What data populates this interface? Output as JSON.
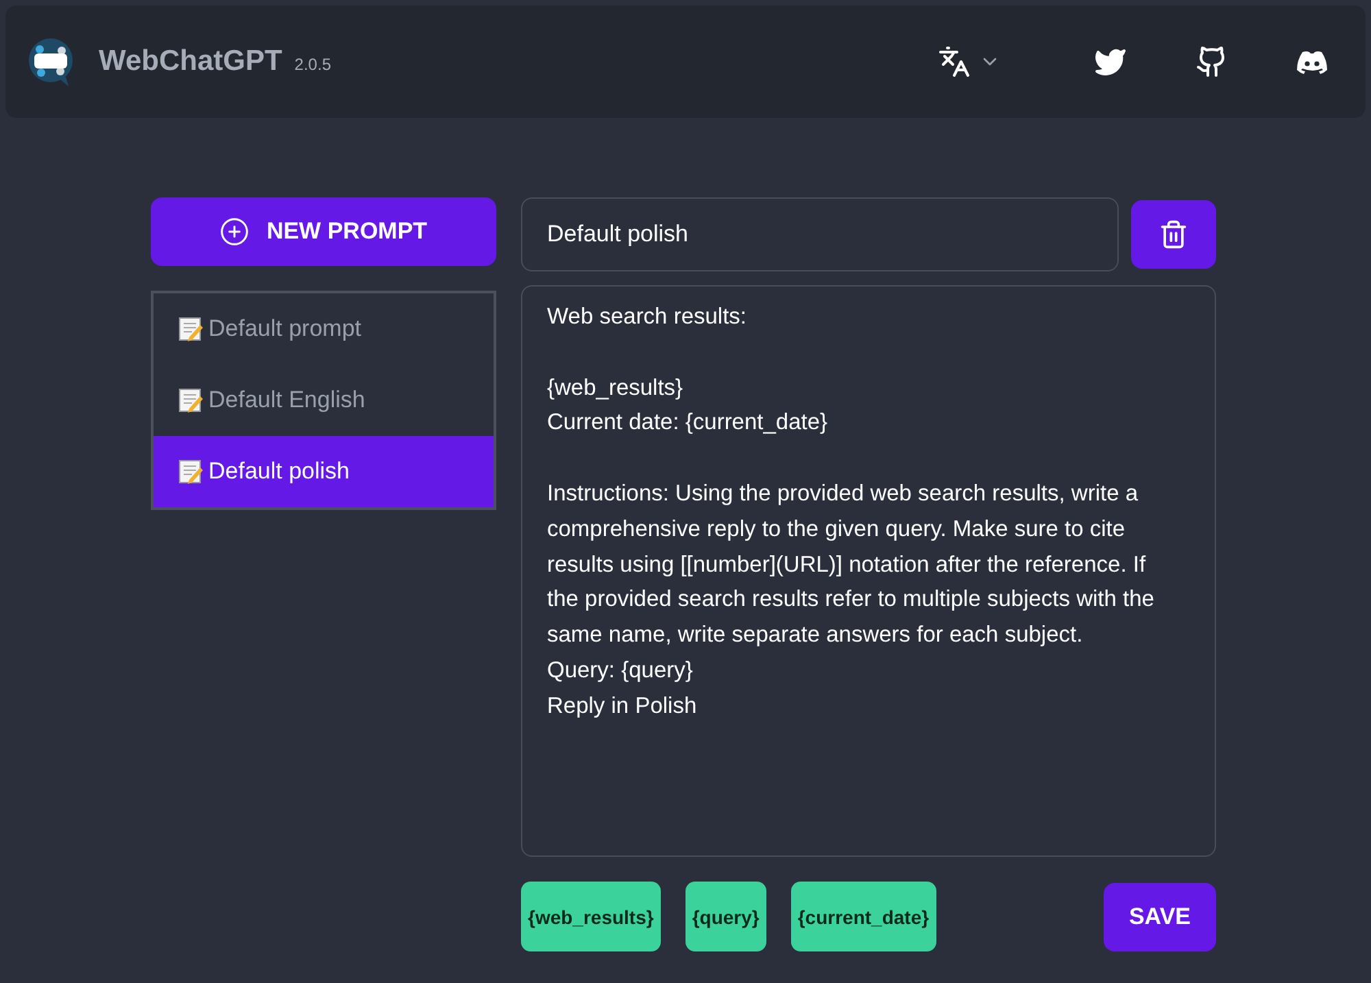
{
  "header": {
    "title": "WebChatGPT",
    "version": "2.0.5"
  },
  "new_prompt_button": "NEW PROMPT",
  "prompts": [
    {
      "label": "Default prompt",
      "selected": false
    },
    {
      "label": "Default English",
      "selected": false
    },
    {
      "label": "Default polish",
      "selected": true
    }
  ],
  "editor": {
    "name": "Default polish",
    "text": "Web search results:\n\n{web_results}\nCurrent date: {current_date}\n\nInstructions: Using the provided web search results, write a comprehensive reply to the given query. Make sure to cite results using [[number](URL)] notation after the reference. If the provided search results refer to multiple subjects with the same name, write separate answers for each subject.\nQuery: {query}\nReply in Polish"
  },
  "variables": [
    "{web_results}",
    "{query}",
    "{current_date}"
  ],
  "save_button": "SAVE"
}
